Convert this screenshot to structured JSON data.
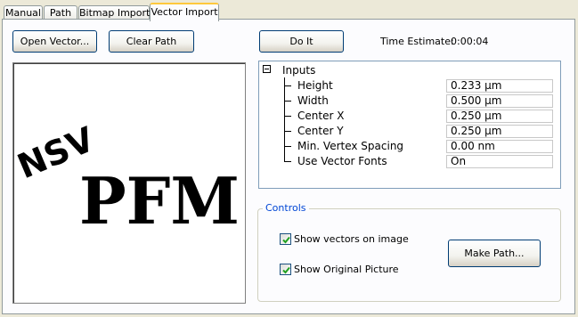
{
  "tabs": [
    {
      "label": "Manual",
      "active": false
    },
    {
      "label": "Path",
      "active": false
    },
    {
      "label": "Bitmap Import",
      "active": false
    },
    {
      "label": "Vector Import",
      "active": true
    }
  ],
  "toolbar": {
    "open_vector": "Open Vector...",
    "clear_path": "Clear Path",
    "do_it": "Do It"
  },
  "estimate": {
    "label": "Time Estimate:",
    "value": "0:00:04"
  },
  "image": {
    "alt_text_top": "NSV",
    "alt_text_main": "PFM"
  },
  "inputs": {
    "header": "Inputs",
    "expanded": true,
    "rows": [
      {
        "label": "Height",
        "value": "0.233 µm"
      },
      {
        "label": "Width",
        "value": "0.500 µm"
      },
      {
        "label": "Center X",
        "value": "0.250 µm"
      },
      {
        "label": "Center Y",
        "value": "0.250 µm"
      },
      {
        "label": "Min. Vertex Spacing",
        "value": "0.00 nm"
      },
      {
        "label": "Use Vector Fonts",
        "value": "On"
      }
    ]
  },
  "controls": {
    "title": "Controls",
    "show_vectors": {
      "label": "Show vectors on image",
      "checked": true
    },
    "show_original": {
      "label": "Show Original Picture",
      "checked": true
    },
    "make_path": "Make Path..."
  },
  "colors": {
    "tab_highlight": "#ffc83c",
    "group_title": "#0046d5",
    "checkmark": "#21a121"
  }
}
